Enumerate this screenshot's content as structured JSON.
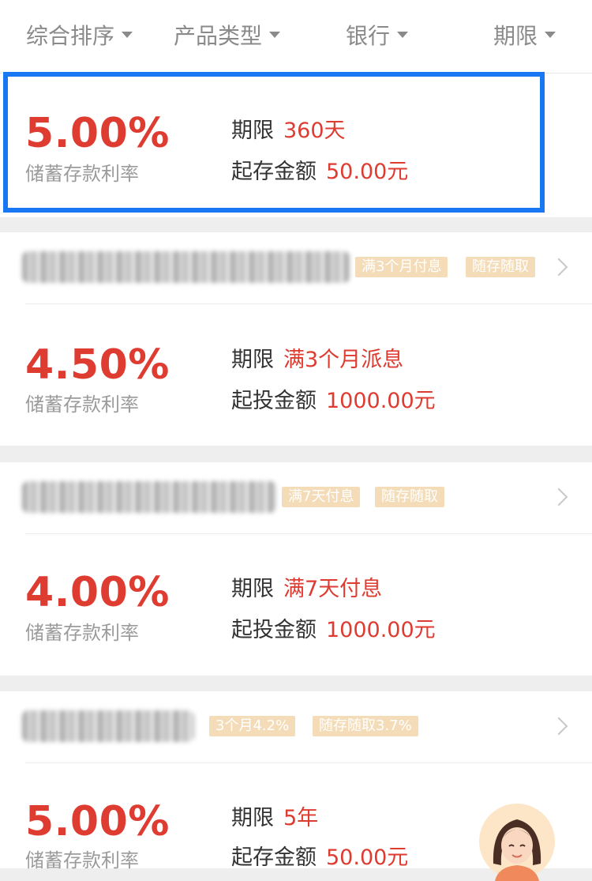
{
  "filters": [
    {
      "label": "综合排序"
    },
    {
      "label": "产品类型"
    },
    {
      "label": "银行"
    },
    {
      "label": "期限"
    }
  ],
  "products": [
    {
      "rate": "5.00%",
      "rate_label": "储蓄存款利率",
      "term_label": "期限",
      "term_value": "360天",
      "min_label": "起存金额",
      "min_value": "50.00元",
      "highlighted": true
    },
    {
      "tags": [
        "满3个月付息",
        "随存随取"
      ],
      "rate": "4.50%",
      "rate_label": "储蓄存款利率",
      "term_label": "期限",
      "term_value": "满3个月派息",
      "min_label": "起投金额",
      "min_value": "1000.00元"
    },
    {
      "tags": [
        "满7天付息",
        "随存随取"
      ],
      "rate": "4.00%",
      "rate_label": "储蓄存款利率",
      "term_label": "期限",
      "term_value": "满7天付息",
      "min_label": "起投金额",
      "min_value": "1000.00元"
    },
    {
      "tags": [
        "3个月4.2%",
        "随存随取3.7%"
      ],
      "rate": "5.00%",
      "rate_label": "储蓄存款利率",
      "term_label": "期限",
      "term_value": "5年",
      "min_label": "起存金额",
      "min_value": "50.00元"
    }
  ],
  "colors": {
    "rate_red": "#de3b31",
    "tag_bg": "#f3dcb7",
    "highlight_blue": "#1877f2"
  }
}
